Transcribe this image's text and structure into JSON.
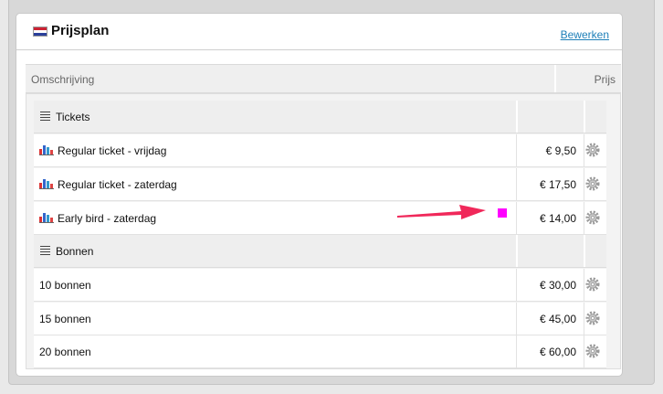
{
  "panel": {
    "title": "Prijsplan",
    "edit_label": "Bewerken"
  },
  "columns": {
    "description": "Omschrijving",
    "price": "Prijs"
  },
  "groups": [
    {
      "name": "Tickets",
      "rows": [
        {
          "label": "Regular ticket - vrijdag",
          "price": "€ 9,50"
        },
        {
          "label": "Regular ticket - zaterdag",
          "price": "€ 17,50"
        },
        {
          "label": "Early bird - zaterdag",
          "price": "€ 14,00"
        }
      ]
    },
    {
      "name": "Bonnen",
      "rows": [
        {
          "label": "10 bonnen",
          "price": "€ 30,00"
        },
        {
          "label": "15 bonnen",
          "price": "€ 45,00"
        },
        {
          "label": "20 bonnen",
          "price": "€ 60,00"
        }
      ]
    }
  ],
  "colors": {
    "link": "#1d7fb8",
    "annotation_arrow": "#f0285a",
    "annotation_marker": "#ff00ff"
  }
}
